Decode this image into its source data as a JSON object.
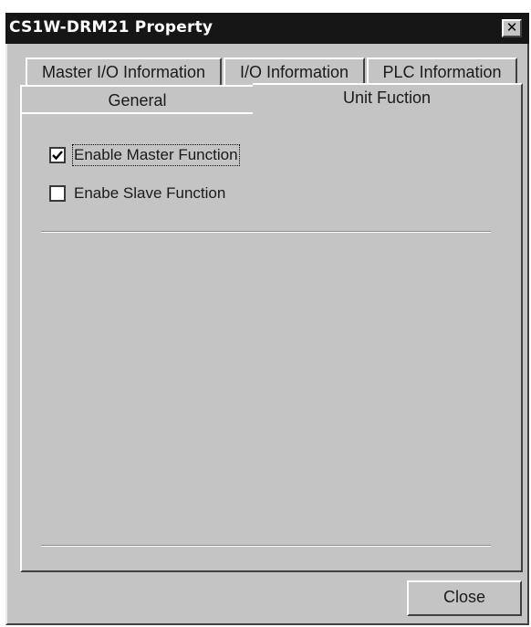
{
  "window": {
    "title": "CS1W-DRM21 Property",
    "close_glyph": "✕"
  },
  "tabs": {
    "back_row": [
      {
        "label": "Master I/O Information"
      },
      {
        "label": "I/O Information"
      },
      {
        "label": "PLC Information"
      }
    ],
    "front_row": [
      {
        "label": "General"
      },
      {
        "label": "Unit Fuction",
        "active": true
      }
    ]
  },
  "panel": {
    "enable_master": {
      "label": "Enable Master Function",
      "checked": true
    },
    "enable_slave": {
      "label": "Enabe Slave Function",
      "checked": false
    }
  },
  "buttons": {
    "close": "Close"
  }
}
